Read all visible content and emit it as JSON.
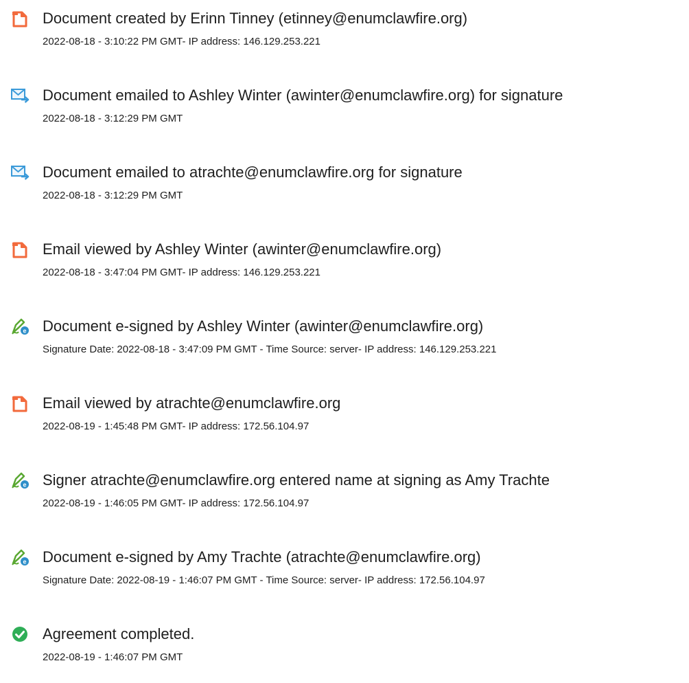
{
  "events": [
    {
      "icon": "document-created-icon",
      "title": "Document created by Erinn Tinney (etinney@enumclawfire.org)",
      "detail": "2022-08-18 - 3:10:22 PM GMT- IP address: 146.129.253.221"
    },
    {
      "icon": "email-sent-icon",
      "title": "Document emailed to Ashley Winter (awinter@enumclawfire.org) for signature",
      "detail": "2022-08-18 - 3:12:29 PM GMT"
    },
    {
      "icon": "email-sent-icon",
      "title": "Document emailed to atrachte@enumclawfire.org for signature",
      "detail": "2022-08-18 - 3:12:29 PM GMT"
    },
    {
      "icon": "email-viewed-icon",
      "title": "Email viewed by Ashley Winter (awinter@enumclawfire.org)",
      "detail": "2022-08-18 - 3:47:04 PM GMT- IP address: 146.129.253.221"
    },
    {
      "icon": "e-signature-icon",
      "title": "Document e-signed by Ashley Winter (awinter@enumclawfire.org)",
      "detail": "Signature Date: 2022-08-18 - 3:47:09 PM GMT - Time Source: server- IP address: 146.129.253.221"
    },
    {
      "icon": "email-viewed-icon",
      "title": "Email viewed by atrachte@enumclawfire.org",
      "detail": "2022-08-19 - 1:45:48 PM GMT- IP address: 172.56.104.97"
    },
    {
      "icon": "e-signature-icon",
      "title": "Signer atrachte@enumclawfire.org entered name at signing as Amy Trachte",
      "detail": "2022-08-19 - 1:46:05 PM GMT- IP address: 172.56.104.97"
    },
    {
      "icon": "e-signature-icon",
      "title": "Document e-signed by Amy Trachte (atrachte@enumclawfire.org)",
      "detail": "Signature Date: 2022-08-19 - 1:46:07 PM GMT - Time Source: server- IP address: 172.56.104.97"
    },
    {
      "icon": "agreement-completed-icon",
      "title": "Agreement completed.",
      "detail": "2022-08-19 - 1:46:07 PM GMT"
    }
  ],
  "colors": {
    "document_icon": "#f26a3c",
    "email_icon": "#3a9ad9",
    "signature_pen": "#5aa832",
    "signature_badge": "#2e8fc9",
    "completed_icon": "#2fae57",
    "text": "#1e1e1e"
  }
}
